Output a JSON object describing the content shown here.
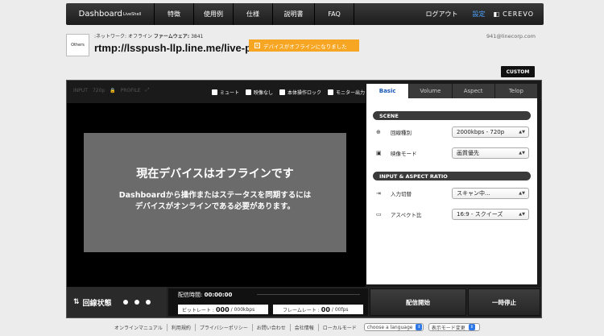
{
  "nav": {
    "brand": "Dashboard",
    "brand_sup": "LiveShell",
    "items": [
      "特徴",
      "使用例",
      "仕様",
      "説明書",
      "FAQ"
    ],
    "login": "ログアウト",
    "settings": "設定",
    "logo": "CEREVO"
  },
  "device": {
    "box_label": "Others",
    "network_label": ":ネットワーク:",
    "network_value": "オフライン",
    "firmware_label": "ファームウェア:",
    "firmware_value": "3841",
    "url": "rtmp://lsspush-llp.line.me/live-p",
    "offline_badge": "デバイスがオフラインになりました",
    "email": "941@linecorp.com",
    "custom_button": "CUSTOM"
  },
  "preview": {
    "icons": [
      "INPUT",
      "720p",
      "PROFILE"
    ],
    "toggles": [
      "ミュート",
      "映像なし",
      "本体操作ロック",
      "モニター出力"
    ],
    "offline_title": "現在デバイスはオフラインです",
    "offline_line1": "Dashboardから操作またはステータスを同期するには",
    "offline_line2": "デバイスがオンラインである必要があります。"
  },
  "side": {
    "tabs": [
      "Basic",
      "Volume",
      "Aspect",
      "Telop"
    ],
    "scene_head": "SCENE",
    "input_head": "INPUT & ASPECT RATIO",
    "rows": [
      {
        "label": "回線種別",
        "value": "2000kbps - 720p"
      },
      {
        "label": "映像モード",
        "value": "画質優先"
      },
      {
        "label": "入力切替",
        "value": "スキャン中..."
      },
      {
        "label": "アスペクト比",
        "value": "16:9 - スクイーズ"
      }
    ]
  },
  "bottom": {
    "line_status": "回線状態",
    "time_label": "配信時間:",
    "time_value": "00:00:00",
    "bitrate_label": "ビットレート :",
    "bitrate_value": "000",
    "bitrate_unit": "/ 000kbps",
    "fps_label": "フレームレート :",
    "fps_value": "00",
    "fps_unit": "/ 00fps",
    "start_button": "配信開始",
    "pause_button": "一時停止"
  },
  "footer": {
    "links": [
      "オンラインマニュアル",
      "利用規約",
      "プライバシーポリシー",
      "お問い合わせ",
      "会社情報",
      "ローカルモード"
    ],
    "language_select": "choose a language",
    "mode_select": "表示モード変更"
  }
}
